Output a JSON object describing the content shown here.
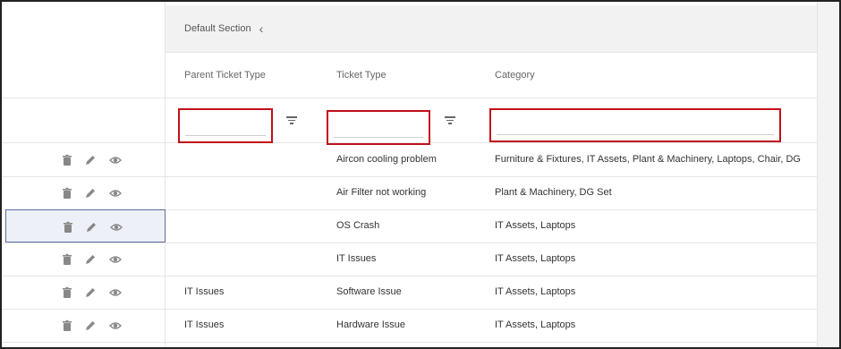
{
  "section": {
    "label": "Default Section",
    "toggle_icon": "chevron-left-icon"
  },
  "columns": {
    "parent": "Parent Ticket Type",
    "type": "Ticket Type",
    "category": "Category"
  },
  "filters": {
    "parent_value": "",
    "type_value": "",
    "category_value": "",
    "filter_icon": "filter-icon"
  },
  "actions": {
    "delete_icon": "trash-icon",
    "edit_icon": "pencil-icon",
    "view_icon": "eye-icon"
  },
  "rows": [
    {
      "parent": "",
      "type": "Aircon cooling problem",
      "category": "Furniture & Fixtures, IT Assets, Plant & Machinery, Laptops, Chair, DG"
    },
    {
      "parent": "",
      "type": "Air Filter not working",
      "category": "Plant & Machinery, DG Set"
    },
    {
      "parent": "",
      "type": "OS Crash",
      "category": "IT Assets, Laptops"
    },
    {
      "parent": "",
      "type": "IT Issues",
      "category": "IT Assets, Laptops"
    },
    {
      "parent": "IT Issues",
      "type": "Software Issue",
      "category": "IT Assets, Laptops"
    },
    {
      "parent": "IT Issues",
      "type": "Hardware Issue",
      "category": "IT Assets, Laptops"
    }
  ],
  "colors": {
    "highlight_border": "#c0101a",
    "selected_row_bg": "#eef0f8",
    "selected_row_border": "#5c6e9a"
  }
}
